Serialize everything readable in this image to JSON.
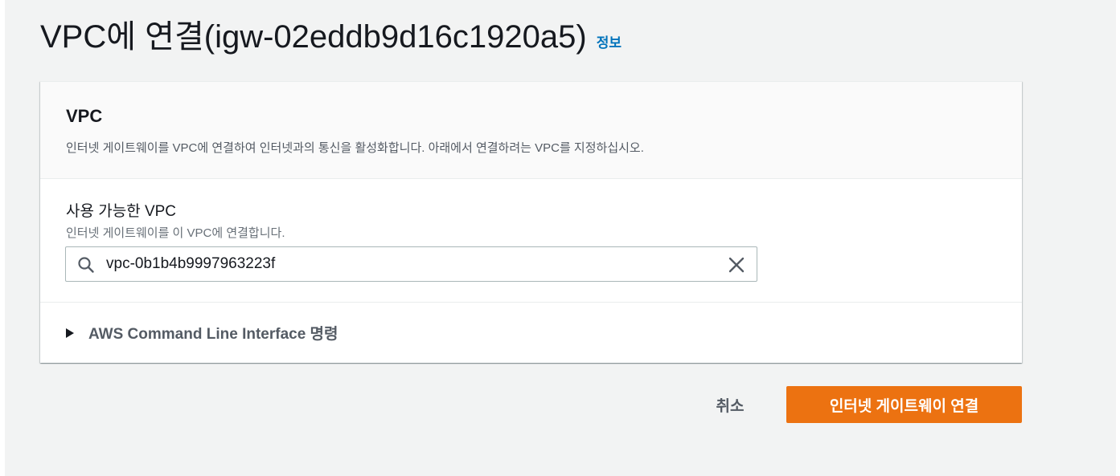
{
  "header": {
    "title": "VPC에 연결(igw-02eddb9d16c1920a5)",
    "info_link": "정보"
  },
  "vpc_section": {
    "title": "VPC",
    "description": "인터넷 게이트웨이를 VPC에 연결하여 인터넷과의 통신을 활성화합니다. 아래에서 연결하려는 VPC를 지정하십시오."
  },
  "available_vpc": {
    "label": "사용 가능한 VPC",
    "description": "인터넷 게이트웨이를 이 VPC에 연결합니다.",
    "value": "vpc-0b1b4b9997963223f",
    "search_icon": "search-icon",
    "clear_icon": "close-icon"
  },
  "cli_expander": {
    "label": "AWS Command Line Interface 명령",
    "icon": "caret-right-icon"
  },
  "footer": {
    "cancel_label": "취소",
    "submit_label": "인터넷 게이트웨이 연결"
  },
  "colors": {
    "primary": "#ec7211",
    "link": "#0073bb",
    "background": "#f2f3f3"
  }
}
